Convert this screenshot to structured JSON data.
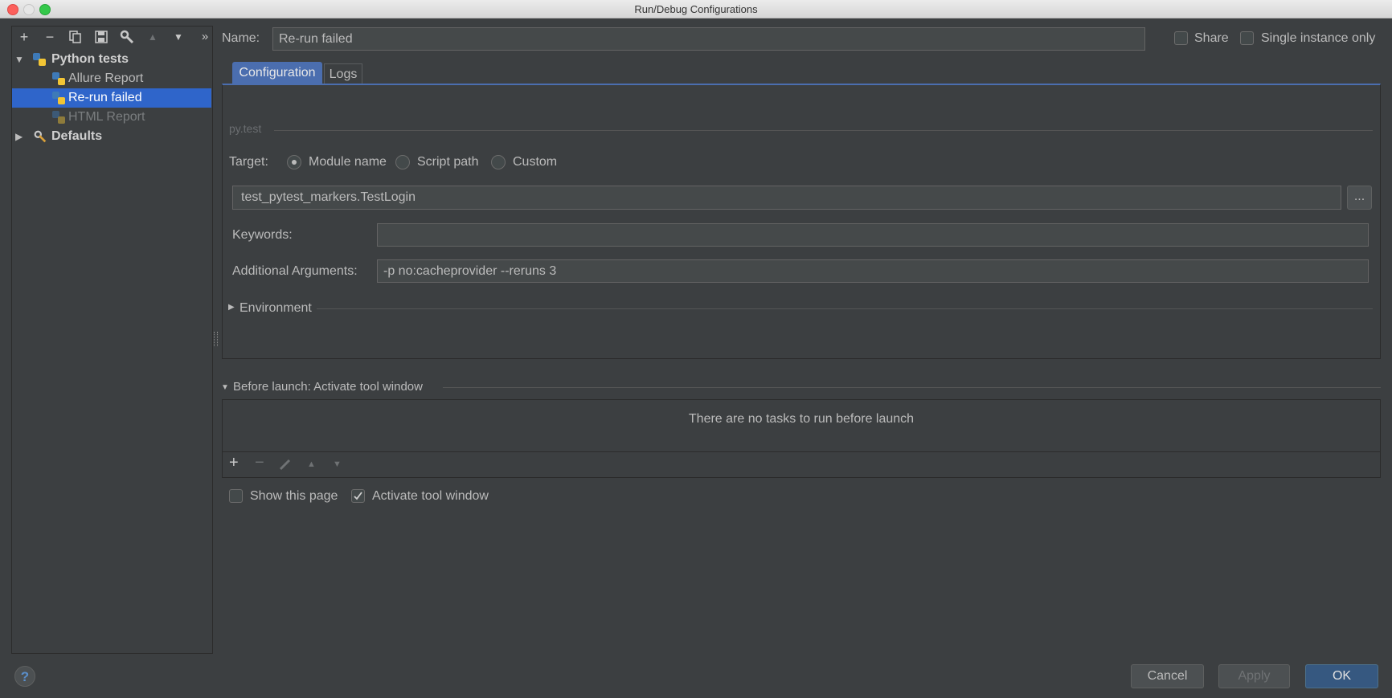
{
  "window": {
    "title": "Run/Debug Configurations"
  },
  "toolbar": {
    "add": "+",
    "remove": "−",
    "copy_icon": "copy-icon",
    "save_icon": "save-icon",
    "edit_defaults_icon": "wrench-icon",
    "move_up": "▲",
    "move_down": "▼",
    "more": "»"
  },
  "tree": {
    "group": "Python tests",
    "items": [
      "Allure Report",
      "Re-run failed",
      "HTML Report"
    ],
    "defaults": "Defaults",
    "selected": "Re-run failed"
  },
  "name_field": {
    "label": "Name:",
    "value": "Re-run failed"
  },
  "share": {
    "label": "Share",
    "checked": false
  },
  "single_instance": {
    "label": "Single instance only",
    "checked": false
  },
  "tabs": [
    {
      "label": "Configuration",
      "active": true
    },
    {
      "label": "Logs",
      "active": false
    }
  ],
  "section": {
    "title": "py.test"
  },
  "target": {
    "label": "Target:",
    "options": [
      "Module name",
      "Script path",
      "Custom"
    ],
    "selected": "Module name",
    "value": "test_pytest_markers.TestLogin",
    "browse_label": "..."
  },
  "keywords": {
    "label": "Keywords:",
    "value": ""
  },
  "additional_args": {
    "label": "Additional Arguments:",
    "value": "-p no:cacheprovider --reruns 3"
  },
  "environment": {
    "label": "Environment"
  },
  "before_launch": {
    "title": "Before launch: Activate tool window",
    "empty_text": "There are no tasks to run before launch",
    "add": "+",
    "remove": "−",
    "edit_icon": "pencil-icon",
    "up": "▲",
    "down": "▼"
  },
  "show_this_page": {
    "label": "Show this page",
    "checked": false
  },
  "activate_tool_window": {
    "label": "Activate tool window",
    "checked": true
  },
  "buttons": {
    "help": "?",
    "cancel": "Cancel",
    "apply": "Apply",
    "ok": "OK"
  },
  "colors": {
    "background": "#3c3f41",
    "selection": "#2f65ca",
    "ok_button": "#365880",
    "field": "#45494a"
  }
}
